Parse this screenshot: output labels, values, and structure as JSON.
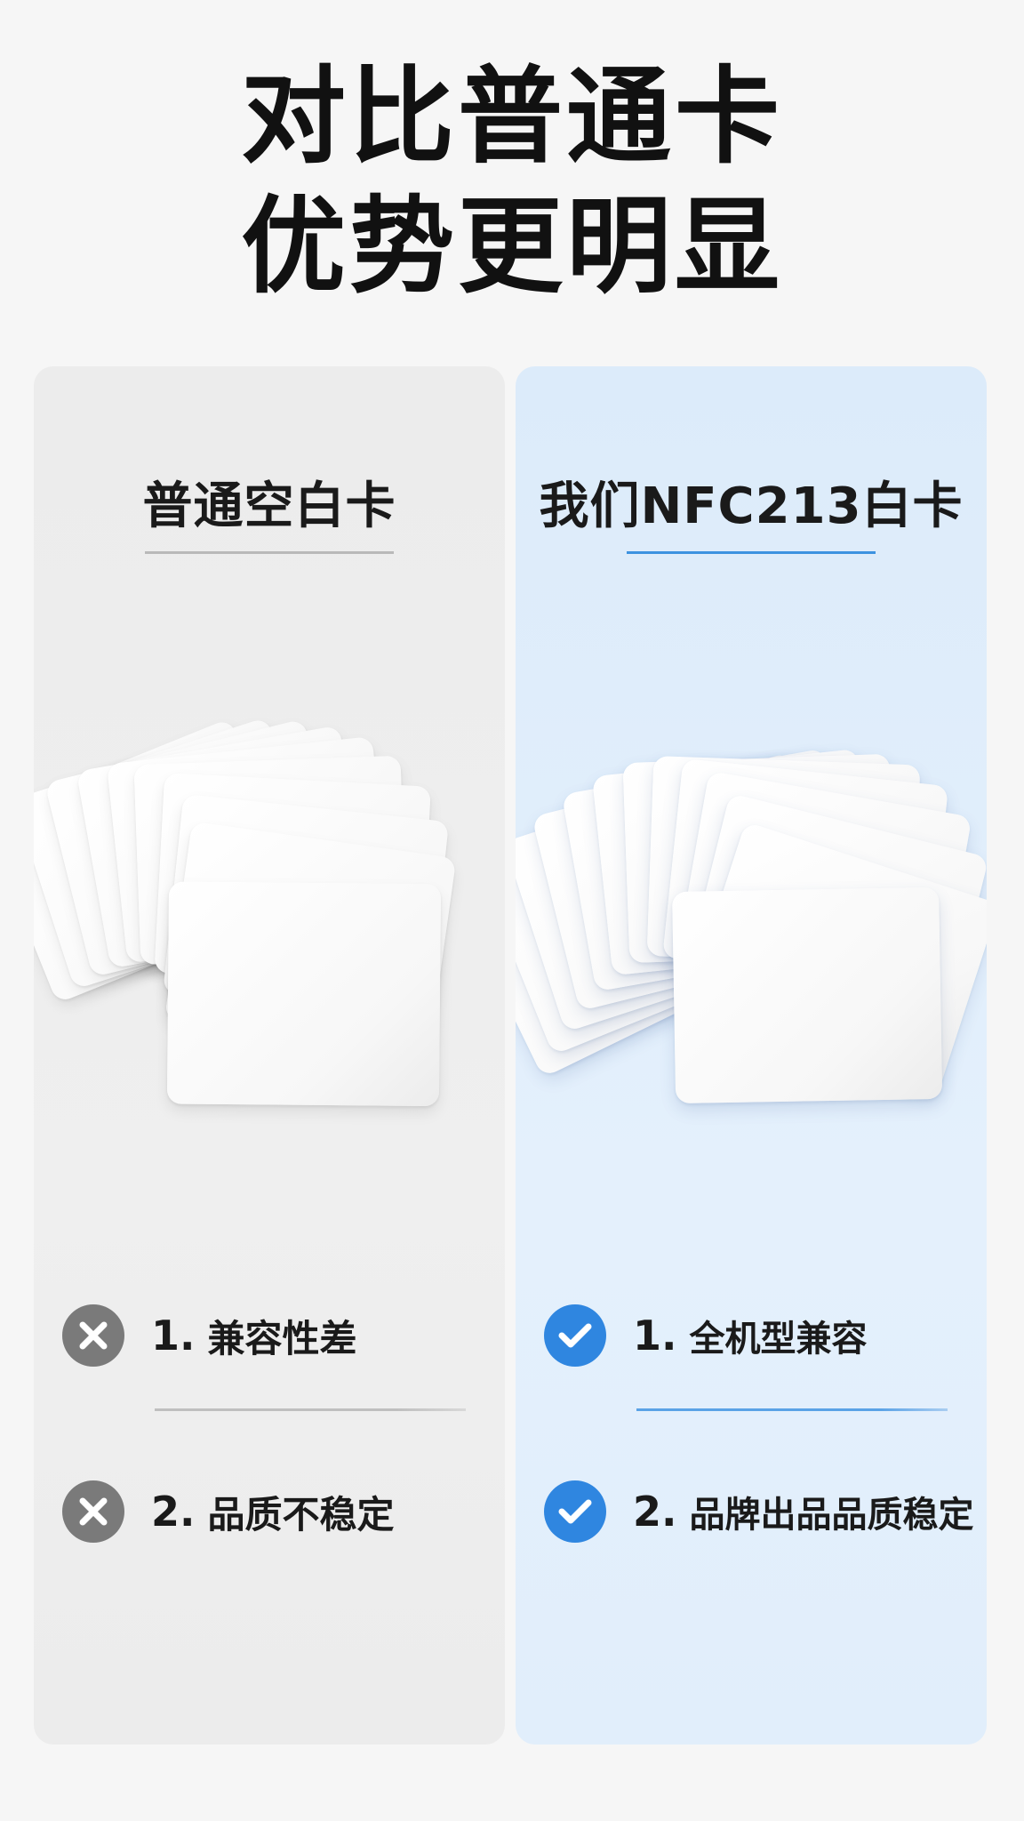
{
  "headline": {
    "line1": "对比普通卡",
    "line2": "优势更明显"
  },
  "left_panel": {
    "title": "普通空白卡",
    "features": [
      {
        "number": "1.",
        "label": "兼容性差",
        "icon": "cross-icon"
      },
      {
        "number": "2.",
        "label": "品质不稳定",
        "icon": "cross-icon"
      }
    ]
  },
  "right_panel": {
    "title": "我们NFC213白卡",
    "features": [
      {
        "number": "1.",
        "label": "全机型兼容",
        "icon": "check-icon"
      },
      {
        "number": "2.",
        "label": "品牌出品品质稳定",
        "icon": "check-icon"
      }
    ]
  },
  "colors": {
    "left_panel_bg": "#ececec",
    "right_panel_bg": "#dcebfa",
    "accent_blue": "#2f86e0",
    "icon_gray": "#7a7a7a"
  }
}
